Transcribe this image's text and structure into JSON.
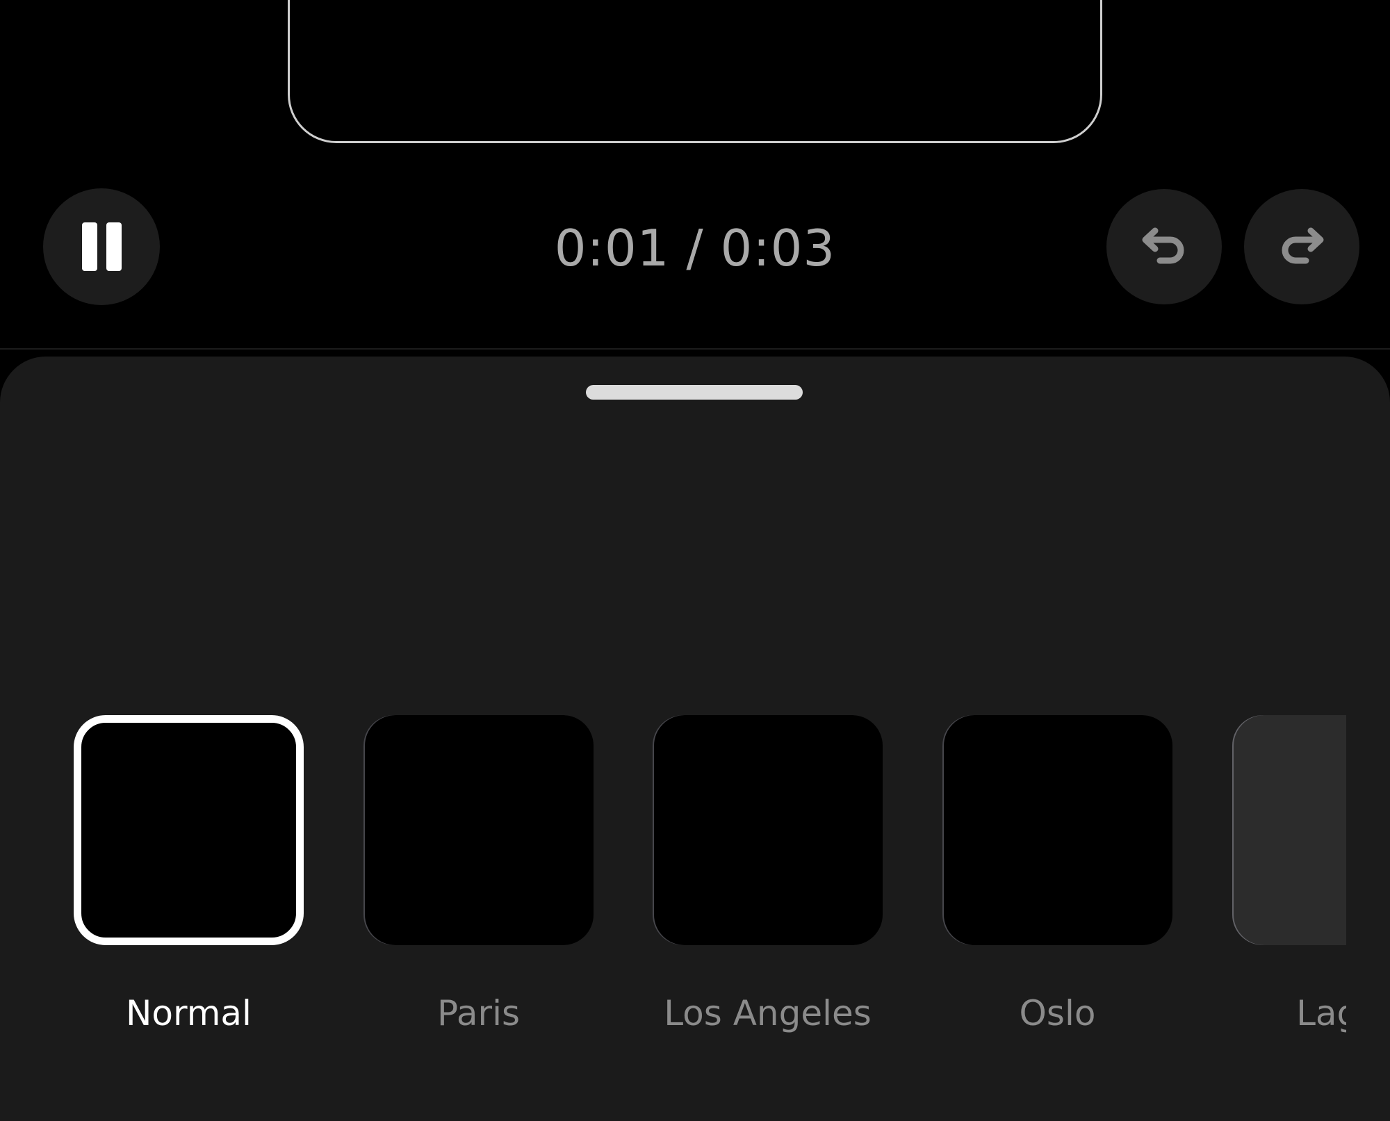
{
  "player": {
    "current_time": "0:01",
    "separator": " / ",
    "total_time": "0:03",
    "time_text": "0:01 / 0:03",
    "pause_icon": "pause-icon",
    "undo_icon": "undo-icon",
    "redo_icon": "redo-icon"
  },
  "filters": {
    "selected": "Normal",
    "items": [
      {
        "label": "Normal",
        "selected": true
      },
      {
        "label": "Paris",
        "selected": false
      },
      {
        "label": "Los Angeles",
        "selected": false
      },
      {
        "label": "Oslo",
        "selected": false
      },
      {
        "label": "Lagos",
        "selected": false,
        "partially_visible": true
      }
    ]
  },
  "colors": {
    "background": "#000000",
    "sheet": "#1b1b1b",
    "button_bg": "#1d1d1d",
    "time_text": "#a9a9a9",
    "label_inactive": "#8b8b8b",
    "label_active": "#ffffff"
  }
}
